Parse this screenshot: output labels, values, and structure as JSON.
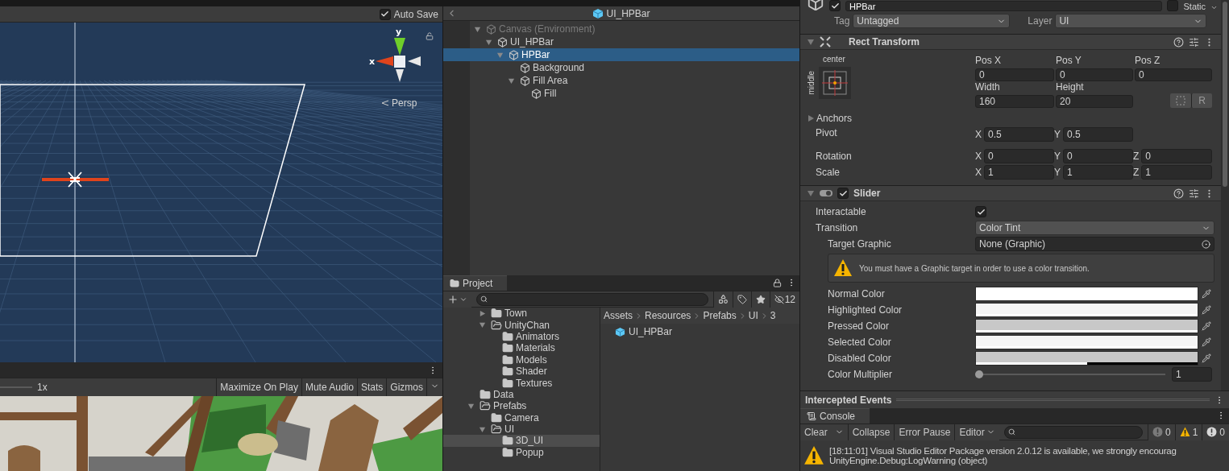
{
  "scene": {
    "auto_save": {
      "label": "Auto Save",
      "checked": true
    },
    "gizmo_labels": {
      "y": "y",
      "x": "x"
    },
    "projection": "Persp"
  },
  "game": {
    "scale": "1x",
    "buttons": [
      "Maximize On Play",
      "Mute Audio",
      "Stats",
      "Gizmos"
    ]
  },
  "hierarchy": {
    "title": "UI_HPBar",
    "items": [
      {
        "label": "Canvas (Environment)",
        "expanded": true,
        "greyed": true,
        "selected": false,
        "children": [
          {
            "label": "UI_HPBar",
            "expanded": true,
            "greyed": false,
            "selected": false,
            "children": [
              {
                "label": "HPBar",
                "expanded": true,
                "greyed": false,
                "selected": true,
                "children": [
                  {
                    "label": "Background",
                    "greyed": false,
                    "selected": false
                  },
                  {
                    "label": "Fill Area",
                    "expanded": true,
                    "greyed": false,
                    "selected": false,
                    "children": [
                      {
                        "label": "Fill",
                        "greyed": false,
                        "selected": false
                      }
                    ]
                  }
                ]
              }
            ]
          }
        ]
      }
    ]
  },
  "project": {
    "tab": "Project",
    "hidden_count": "12",
    "folders": [
      {
        "kind": "offscreen",
        "children": [
          {
            "kind": "folder",
            "label": "Town",
            "expanded": false,
            "selected": false
          },
          {
            "kind": "folder",
            "label": "UnityChan",
            "expanded": true,
            "selected": false,
            "children": [
              {
                "kind": "folder",
                "label": "Animators",
                "selected": false
              },
              {
                "kind": "folder",
                "label": "Materials",
                "selected": false
              },
              {
                "kind": "folder",
                "label": "Models",
                "selected": false
              },
              {
                "kind": "folder",
                "label": "Shader",
                "selected": false
              },
              {
                "kind": "folder",
                "label": "Textures",
                "selected": false
              }
            ]
          }
        ]
      },
      {
        "kind": "folder",
        "label": "Data",
        "selected": false
      },
      {
        "kind": "folder",
        "label": "Prefabs",
        "expanded": true,
        "selected": false,
        "children": [
          {
            "kind": "folder",
            "label": "Camera",
            "selected": false
          },
          {
            "kind": "folder",
            "label": "UI",
            "expanded": true,
            "selected": false,
            "children": [
              {
                "kind": "folder",
                "label": "3D_UI",
                "selected": true
              },
              {
                "kind": "folder",
                "label": "Popup",
                "selected": false
              }
            ]
          }
        ]
      }
    ],
    "breadcrumb": [
      "Assets",
      "Resources",
      "Prefabs",
      "UI",
      "3"
    ],
    "assets": [
      "UI_HPBar"
    ]
  },
  "inspector": {
    "name": "HPBar",
    "active": true,
    "static": {
      "label": "Static",
      "checked": false
    },
    "tag": {
      "label": "Tag",
      "value": "Untagged"
    },
    "layer": {
      "label": "Layer",
      "value": "UI"
    },
    "rect_transform": {
      "title": "Rect Transform",
      "expanded": true,
      "anchor_h": "center",
      "anchor_v": "middle",
      "fields": [
        {
          "label": "Pos X",
          "value": "0"
        },
        {
          "label": "Pos Y",
          "value": "0"
        },
        {
          "label": "Pos Z",
          "value": "0"
        },
        {
          "label": "Width",
          "value": "160"
        },
        {
          "label": "Height",
          "value": "20"
        }
      ],
      "reset_button": "R",
      "anchors": {
        "label": "Anchors",
        "expanded": false
      },
      "rows": [
        {
          "label": "Pivot",
          "axes": [
            {
              "axis": "X",
              "value": "0.5"
            },
            {
              "axis": "Y",
              "value": "0.5"
            }
          ]
        },
        {
          "label": "Rotation",
          "axes": [
            {
              "axis": "X",
              "value": "0"
            },
            {
              "axis": "Y",
              "value": "0"
            },
            {
              "axis": "Z",
              "value": "0"
            }
          ]
        },
        {
          "label": "Scale",
          "axes": [
            {
              "axis": "X",
              "value": "1"
            },
            {
              "axis": "Y",
              "value": "1"
            },
            {
              "axis": "Z",
              "value": "1"
            }
          ]
        }
      ]
    },
    "slider": {
      "title": "Slider",
      "expanded": true,
      "enabled": true,
      "interactable": {
        "label": "Interactable",
        "checked": true
      },
      "transition": {
        "label": "Transition",
        "value": "Color Tint"
      },
      "target_graphic": {
        "label": "Target Graphic",
        "value": "None (Graphic)"
      },
      "warning": "You must have a Graphic target in order to use a color transition.",
      "colors": [
        {
          "label": "Normal Color",
          "color": "#ffffff",
          "level": 1
        },
        {
          "label": "Highlighted Color",
          "color": "#f5f5f5",
          "level": 1
        },
        {
          "label": "Pressed Color",
          "color": "#c8c8c8",
          "level": 1
        },
        {
          "label": "Selected Color",
          "color": "#f5f5f5",
          "level": 1
        },
        {
          "label": "Disabled Color",
          "color": "#c8c8c8",
          "level": 0.5
        }
      ],
      "multiplier": {
        "label": "Color Multiplier",
        "level": 0,
        "value": "1"
      }
    },
    "intercepted_events": "Intercepted Events"
  },
  "console": {
    "tab": "Console",
    "buttons": [
      "Clear",
      "Collapse",
      "Error Pause",
      "Editor"
    ],
    "counts": [
      {
        "kind": "info",
        "count": "0"
      },
      {
        "kind": "warning",
        "count": "1"
      },
      {
        "kind": "error",
        "count": "0"
      }
    ],
    "messages": [
      {
        "kind": "warning",
        "lines": [
          "[18:11:01] Visual Studio Editor Package version 2.0.12 is available, we strongly encourag",
          "UnityEngine.Debug:LogWarning (object)"
        ]
      }
    ]
  }
}
